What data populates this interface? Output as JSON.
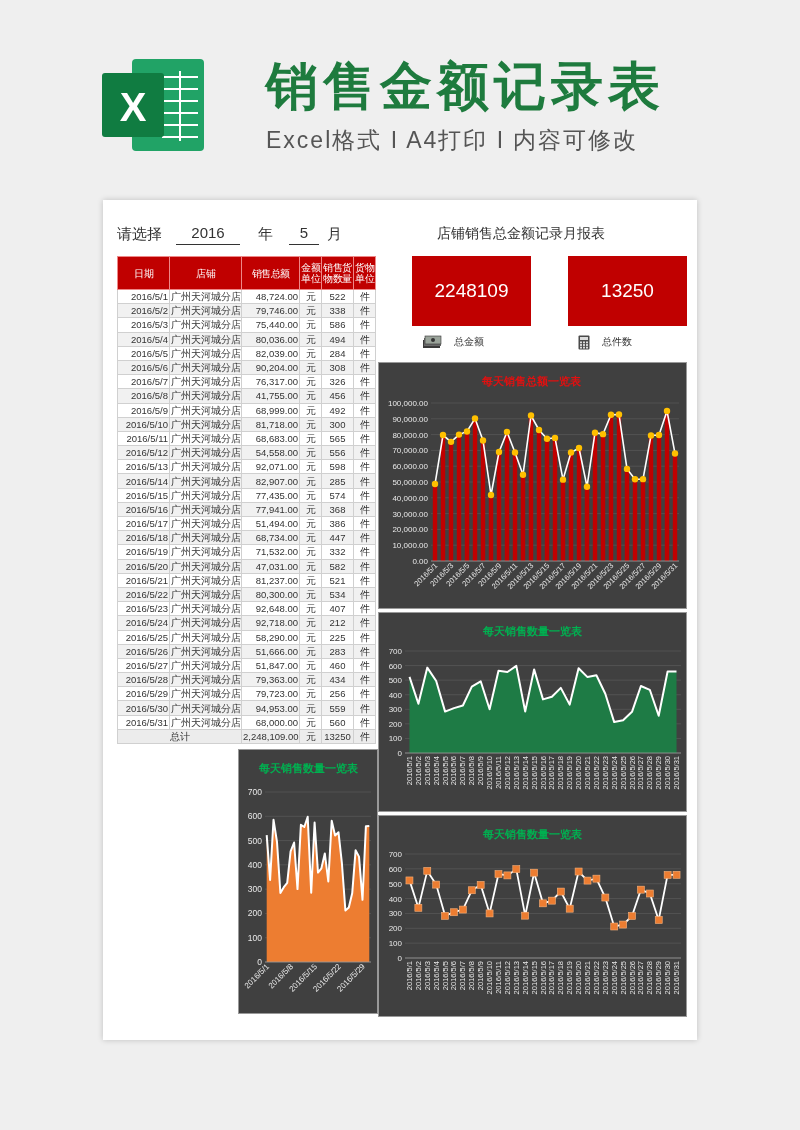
{
  "header": {
    "logo_letter": "X",
    "title": "销售金额记录表",
    "subtitle": "Excel格式 I A4打印 I 内容可修改"
  },
  "sheet": {
    "prompt": "请选择",
    "year": "2016",
    "year_unit": "年",
    "month": "5",
    "month_unit": "月",
    "report_title": "店铺销售总金额记录月报表",
    "table": {
      "columns": [
        "日期",
        "店铺",
        "销售总额",
        "金额单位",
        "销售货物数量",
        "货物单位"
      ],
      "rows": [
        {
          "date": "2016/5/1",
          "store": "广州天河城分店",
          "amount": "48,724.00",
          "currency": "元",
          "qty": "522",
          "unit": "件"
        },
        {
          "date": "2016/5/2",
          "store": "广州天河城分店",
          "amount": "79,746.00",
          "currency": "元",
          "qty": "338",
          "unit": "件"
        },
        {
          "date": "2016/5/3",
          "store": "广州天河城分店",
          "amount": "75,440.00",
          "currency": "元",
          "qty": "586",
          "unit": "件"
        },
        {
          "date": "2016/5/4",
          "store": "广州天河城分店",
          "amount": "80,036.00",
          "currency": "元",
          "qty": "494",
          "unit": "件"
        },
        {
          "date": "2016/5/5",
          "store": "广州天河城分店",
          "amount": "82,039.00",
          "currency": "元",
          "qty": "284",
          "unit": "件"
        },
        {
          "date": "2016/5/6",
          "store": "广州天河城分店",
          "amount": "90,204.00",
          "currency": "元",
          "qty": "308",
          "unit": "件"
        },
        {
          "date": "2016/5/7",
          "store": "广州天河城分店",
          "amount": "76,317.00",
          "currency": "元",
          "qty": "326",
          "unit": "件"
        },
        {
          "date": "2016/5/8",
          "store": "广州天河城分店",
          "amount": "41,755.00",
          "currency": "元",
          "qty": "456",
          "unit": "件"
        },
        {
          "date": "2016/5/9",
          "store": "广州天河城分店",
          "amount": "68,999.00",
          "currency": "元",
          "qty": "492",
          "unit": "件"
        },
        {
          "date": "2016/5/10",
          "store": "广州天河城分店",
          "amount": "81,718.00",
          "currency": "元",
          "qty": "300",
          "unit": "件"
        },
        {
          "date": "2016/5/11",
          "store": "广州天河城分店",
          "amount": "68,683.00",
          "currency": "元",
          "qty": "565",
          "unit": "件"
        },
        {
          "date": "2016/5/12",
          "store": "广州天河城分店",
          "amount": "54,558.00",
          "currency": "元",
          "qty": "556",
          "unit": "件"
        },
        {
          "date": "2016/5/13",
          "store": "广州天河城分店",
          "amount": "92,071.00",
          "currency": "元",
          "qty": "598",
          "unit": "件"
        },
        {
          "date": "2016/5/14",
          "store": "广州天河城分店",
          "amount": "82,907.00",
          "currency": "元",
          "qty": "285",
          "unit": "件"
        },
        {
          "date": "2016/5/15",
          "store": "广州天河城分店",
          "amount": "77,435.00",
          "currency": "元",
          "qty": "574",
          "unit": "件"
        },
        {
          "date": "2016/5/16",
          "store": "广州天河城分店",
          "amount": "77,941.00",
          "currency": "元",
          "qty": "368",
          "unit": "件"
        },
        {
          "date": "2016/5/17",
          "store": "广州天河城分店",
          "amount": "51,494.00",
          "currency": "元",
          "qty": "386",
          "unit": "件"
        },
        {
          "date": "2016/5/18",
          "store": "广州天河城分店",
          "amount": "68,734.00",
          "currency": "元",
          "qty": "447",
          "unit": "件"
        },
        {
          "date": "2016/5/19",
          "store": "广州天河城分店",
          "amount": "71,532.00",
          "currency": "元",
          "qty": "332",
          "unit": "件"
        },
        {
          "date": "2016/5/20",
          "store": "广州天河城分店",
          "amount": "47,031.00",
          "currency": "元",
          "qty": "582",
          "unit": "件"
        },
        {
          "date": "2016/5/21",
          "store": "广州天河城分店",
          "amount": "81,237.00",
          "currency": "元",
          "qty": "521",
          "unit": "件"
        },
        {
          "date": "2016/5/22",
          "store": "广州天河城分店",
          "amount": "80,300.00",
          "currency": "元",
          "qty": "534",
          "unit": "件"
        },
        {
          "date": "2016/5/23",
          "store": "广州天河城分店",
          "amount": "92,648.00",
          "currency": "元",
          "qty": "407",
          "unit": "件"
        },
        {
          "date": "2016/5/24",
          "store": "广州天河城分店",
          "amount": "92,718.00",
          "currency": "元",
          "qty": "212",
          "unit": "件"
        },
        {
          "date": "2016/5/25",
          "store": "广州天河城分店",
          "amount": "58,290.00",
          "currency": "元",
          "qty": "225",
          "unit": "件"
        },
        {
          "date": "2016/5/26",
          "store": "广州天河城分店",
          "amount": "51,666.00",
          "currency": "元",
          "qty": "283",
          "unit": "件"
        },
        {
          "date": "2016/5/27",
          "store": "广州天河城分店",
          "amount": "51,847.00",
          "currency": "元",
          "qty": "460",
          "unit": "件"
        },
        {
          "date": "2016/5/28",
          "store": "广州天河城分店",
          "amount": "79,363.00",
          "currency": "元",
          "qty": "434",
          "unit": "件"
        },
        {
          "date": "2016/5/29",
          "store": "广州天河城分店",
          "amount": "79,723.00",
          "currency": "元",
          "qty": "256",
          "unit": "件"
        },
        {
          "date": "2016/5/30",
          "store": "广州天河城分店",
          "amount": "94,953.00",
          "currency": "元",
          "qty": "559",
          "unit": "件"
        },
        {
          "date": "2016/5/31",
          "store": "广州天河城分店",
          "amount": "68,000.00",
          "currency": "元",
          "qty": "560",
          "unit": "件"
        }
      ],
      "total": {
        "label": "总计",
        "amount": "2,248,109.00",
        "currency": "元",
        "qty": "13250",
        "unit": "件"
      }
    },
    "cards": [
      {
        "kind": "cash",
        "value": "2248109",
        "label": "总金额"
      },
      {
        "kind": "calculator",
        "value": "13250",
        "label": "总件数"
      }
    ],
    "charts": [
      {
        "chart_data": {
          "type": "bar",
          "title": "每天销售总额一览表",
          "grid": true,
          "categories": [
            "2016/5/1",
            null,
            "2016/5/3",
            null,
            "2016/5/5",
            null,
            "2016/5/7",
            null,
            "2016/5/9",
            null,
            "2016/5/11",
            null,
            "2016/5/13",
            null,
            "2016/5/15",
            null,
            "2016/5/17",
            null,
            "2016/5/19",
            null,
            "2016/5/21",
            null,
            "2016/5/23",
            null,
            "2016/5/25",
            null,
            "2016/5/27",
            null,
            "2016/5/29",
            null,
            "2016/5/31"
          ],
          "series": [
            {
              "color": "#c00000",
              "values": [
                48700,
                79700,
                75400,
                80000,
                82000,
                90200,
                76300,
                41800,
                69000,
                81700,
                68700,
                54600,
                92100,
                82900,
                77400,
                77900,
                51500,
                68700,
                71500,
                47000,
                81200,
                80300,
                92600,
                92700,
                58300,
                51700,
                51800,
                79400,
                79700,
                95000,
                68000
              ]
            },
            {
              "type": "line",
              "marker": "circle",
              "color": "#ffffff",
              "values": [
                48700,
                79700,
                75400,
                80000,
                82000,
                90200,
                76300,
                41800,
                69000,
                81700,
                68700,
                54600,
                92100,
                82900,
                77400,
                77900,
                51500,
                68700,
                71500,
                47000,
                81200,
                80300,
                92600,
                92700,
                58300,
                51700,
                51800,
                79400,
                79700,
                95000,
                68000
              ]
            }
          ],
          "ylim": [
            0,
            100000
          ],
          "yticks": [
            {
              "value": 0,
              "label": "0.00"
            },
            {
              "value": 10000,
              "label": "10,000.00"
            },
            {
              "value": 20000,
              "label": "20,000.00"
            },
            {
              "value": 30000,
              "label": "30,000.00"
            },
            {
              "value": 40000,
              "label": "40,000.00"
            },
            {
              "value": 50000,
              "label": "50,000.00"
            },
            {
              "value": 60000,
              "label": "60,000.00"
            },
            {
              "value": 70000,
              "label": "70,000.00"
            },
            {
              "value": 80000,
              "label": "80,000.00"
            },
            {
              "value": 90000,
              "label": "90,000.00"
            },
            {
              "value": 100000,
              "label": "100,000.00"
            }
          ]
        }
      },
      {
        "chart_data": {
          "type": "area",
          "title": "每天销售数量一览表",
          "grid": true,
          "categories": [
            "2016/5/1",
            "2016/5/2",
            "2016/5/3",
            "2016/5/4",
            "2016/5/5",
            "2016/5/6",
            "2016/5/7",
            "2016/5/8",
            "2016/5/9",
            "2016/5/10",
            "2016/5/11",
            "2016/5/12",
            "2016/5/13",
            "2016/5/14",
            "2016/5/15",
            "2016/5/16",
            "2016/5/17",
            "2016/5/18",
            "2016/5/19",
            "2016/5/20",
            "2016/5/21",
            "2016/5/22",
            "2016/5/23",
            "2016/5/24",
            "2016/5/25",
            "2016/5/26",
            "2016/5/27",
            "2016/5/28",
            "2016/5/29",
            "2016/5/30",
            "2016/5/31"
          ],
          "series": [
            {
              "color": "#1e7b45",
              "values": [
                522,
                338,
                586,
                494,
                284,
                308,
                326,
                456,
                492,
                300,
                565,
                556,
                598,
                285,
                574,
                368,
                386,
                447,
                332,
                582,
                521,
                534,
                407,
                212,
                225,
                283,
                460,
                434,
                256,
                559,
                560
              ]
            }
          ],
          "ylim": [
            0,
            700
          ],
          "yticks": [
            0,
            100,
            200,
            300,
            400,
            500,
            600,
            700
          ]
        }
      },
      {
        "chart_data": {
          "type": "area",
          "title": "每天销售数量一览表",
          "grid": true,
          "categories": [
            "2016/5/1",
            null,
            null,
            null,
            null,
            null,
            null,
            "2016/5/8",
            null,
            null,
            null,
            null,
            null,
            null,
            "2016/5/15",
            null,
            null,
            null,
            null,
            null,
            null,
            "2016/5/22",
            null,
            null,
            null,
            null,
            null,
            null,
            "2016/5/29",
            null,
            null
          ],
          "series": [
            {
              "color": "#ed7d31",
              "values": [
                522,
                338,
                586,
                494,
                284,
                308,
                326,
                456,
                492,
                300,
                565,
                556,
                598,
                285,
                574,
                368,
                386,
                447,
                332,
                582,
                521,
                534,
                407,
                212,
                225,
                283,
                460,
                434,
                256,
                559,
                560
              ]
            }
          ],
          "ylim": [
            0,
            700
          ],
          "yticks": [
            0,
            100,
            200,
            300,
            400,
            500,
            600,
            700
          ]
        }
      },
      {
        "chart_data": {
          "type": "line",
          "title": "每天销售数量一览表",
          "grid": true,
          "categories": [
            "2016/5/1",
            "2016/5/2",
            "2016/5/3",
            "2016/5/4",
            "2016/5/5",
            "2016/5/6",
            "2016/5/7",
            "2016/5/8",
            "2016/5/9",
            "2016/5/10",
            "2016/5/11",
            "2016/5/12",
            "2016/5/13",
            "2016/5/14",
            "2016/5/15",
            "2016/5/16",
            "2016/5/17",
            "2016/5/18",
            "2016/5/19",
            "2016/5/20",
            "2016/5/21",
            "2016/5/22",
            "2016/5/23",
            "2016/5/24",
            "2016/5/25",
            "2016/5/26",
            "2016/5/27",
            "2016/5/28",
            "2016/5/29",
            "2016/5/30",
            "2016/5/31"
          ],
          "series": [
            {
              "marker": "square",
              "color": "#ffffff",
              "values": [
                522,
                338,
                586,
                494,
                284,
                308,
                326,
                456,
                492,
                300,
                565,
                556,
                598,
                285,
                574,
                368,
                386,
                447,
                332,
                582,
                521,
                534,
                407,
                212,
                225,
                283,
                460,
                434,
                256,
                559,
                560
              ]
            }
          ],
          "ylim": [
            0,
            700
          ],
          "yticks": [
            0,
            100,
            200,
            300,
            400,
            500,
            600,
            700
          ]
        }
      }
    ]
  }
}
